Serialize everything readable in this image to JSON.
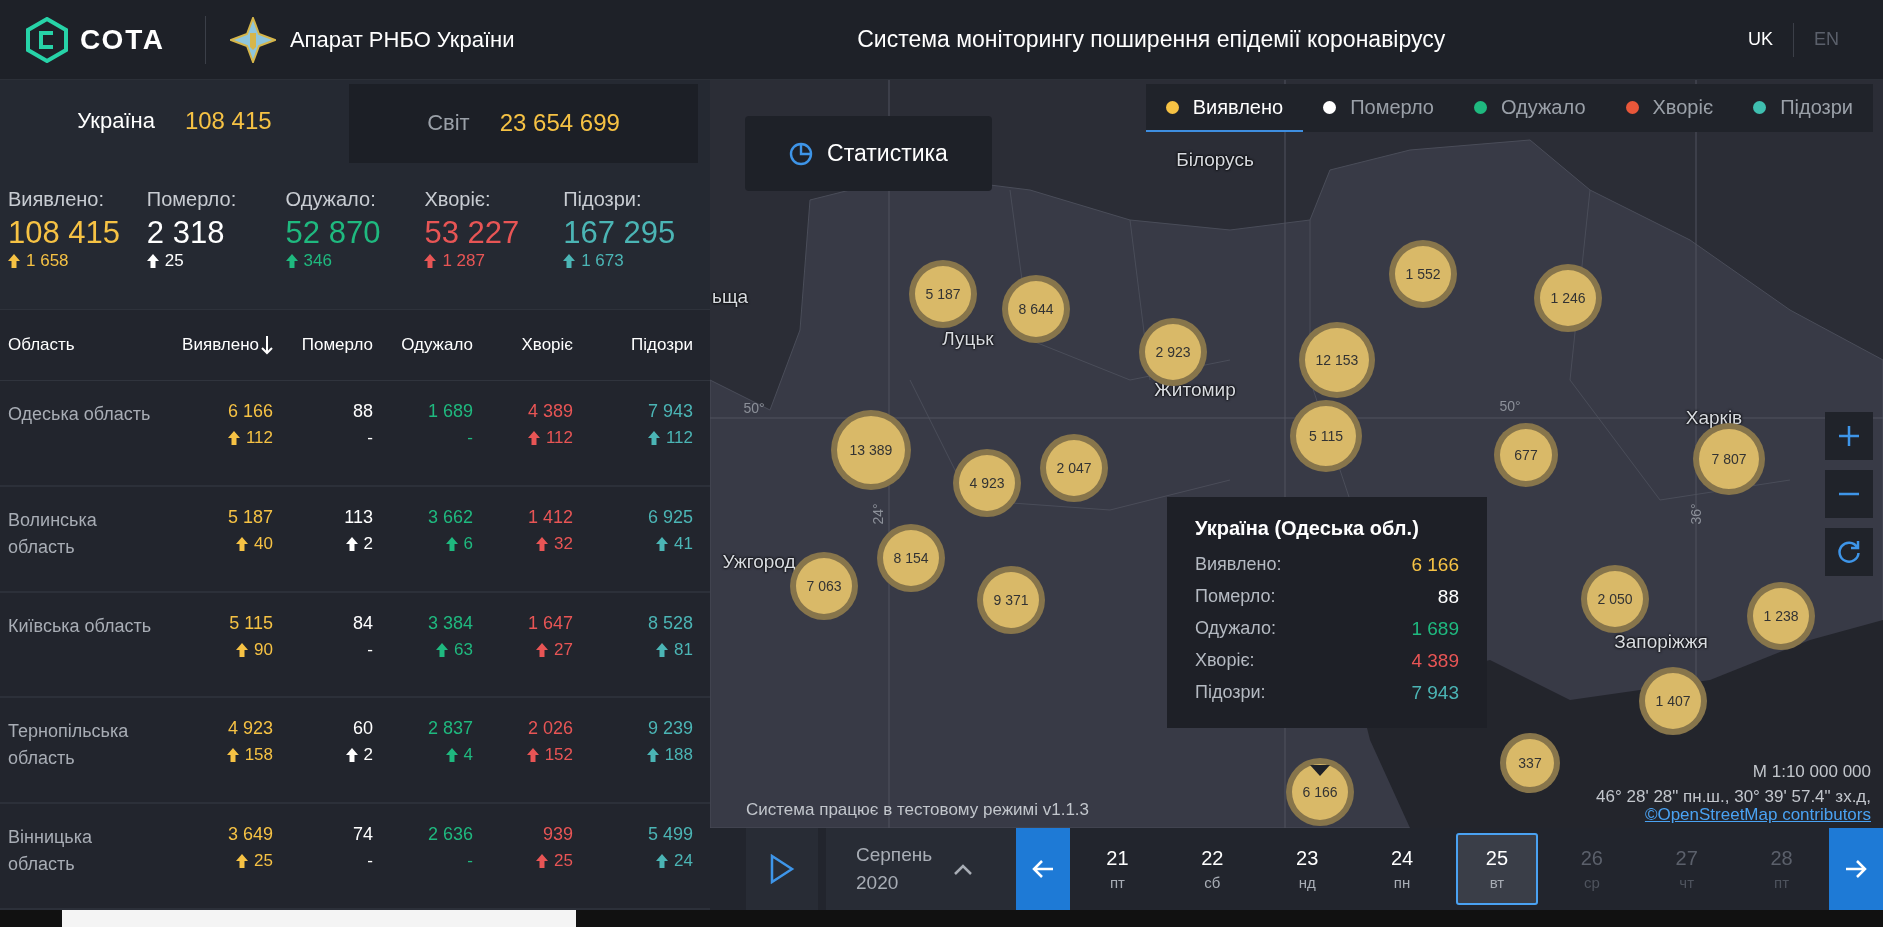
{
  "header": {
    "logo": "СОТА",
    "org": "Апарат РНБО України",
    "title": "Система моніторингу поширення епідемії коронавірусу",
    "languages": [
      {
        "label": "UK",
        "selected": true
      },
      {
        "label": "EN",
        "selected": false
      }
    ]
  },
  "scope_tabs": [
    {
      "label": "Україна",
      "value": "108 415",
      "selected": true
    },
    {
      "label": "Світ",
      "value": "23 654 699",
      "selected": false
    }
  ],
  "totals": [
    {
      "label": "Виявлено:",
      "value": "108 415",
      "delta": "1 658",
      "color": "#f6c244"
    },
    {
      "label": "Померло:",
      "value": "2 318",
      "delta": "25",
      "color": "#ffffff"
    },
    {
      "label": "Одужало:",
      "value": "52 870",
      "delta": "346",
      "color": "#1fb97f"
    },
    {
      "label": "Хворіє:",
      "value": "53 227",
      "delta": "1 287",
      "color": "#e85555"
    },
    {
      "label": "Підозри:",
      "value": "167 295",
      "delta": "1 673",
      "color": "#4bb5b5"
    }
  ],
  "table": {
    "columns": [
      {
        "label": "Область",
        "sorted": false
      },
      {
        "label": "Виявлено",
        "sorted": true,
        "color": "#f6c244"
      },
      {
        "label": "Померло",
        "sorted": false,
        "color": "#ffffff"
      },
      {
        "label": "Одужало",
        "sorted": false,
        "color": "#1fb97f"
      },
      {
        "label": "Хворіє",
        "sorted": false,
        "color": "#e85555"
      },
      {
        "label": "Підозри",
        "sorted": false,
        "color": "#4bb5b5"
      }
    ],
    "rows": [
      {
        "cells": [
          {
            "value": "Одеська область"
          },
          {
            "value": "6 166",
            "delta": "112",
            "up": true
          },
          {
            "value": "88",
            "delta": "-",
            "up": false
          },
          {
            "value": "1 689",
            "delta": "-",
            "up": false
          },
          {
            "value": "4 389",
            "delta": "112",
            "up": true
          },
          {
            "value": "7 943",
            "delta": "112",
            "up": true
          }
        ]
      },
      {
        "cells": [
          {
            "value": "Волинська область"
          },
          {
            "value": "5 187",
            "delta": "40",
            "up": true
          },
          {
            "value": "113",
            "delta": "2",
            "up": true
          },
          {
            "value": "3 662",
            "delta": "6",
            "up": true
          },
          {
            "value": "1 412",
            "delta": "32",
            "up": true
          },
          {
            "value": "6 925",
            "delta": "41",
            "up": true
          }
        ]
      },
      {
        "cells": [
          {
            "value": "Київська область"
          },
          {
            "value": "5 115",
            "delta": "90",
            "up": true
          },
          {
            "value": "84",
            "delta": "-",
            "up": false
          },
          {
            "value": "3 384",
            "delta": "63",
            "up": true
          },
          {
            "value": "1 647",
            "delta": "27",
            "up": true
          },
          {
            "value": "8 528",
            "delta": "81",
            "up": true
          }
        ]
      },
      {
        "cells": [
          {
            "value": "Тернопільська область"
          },
          {
            "value": "4 923",
            "delta": "158",
            "up": true
          },
          {
            "value": "60",
            "delta": "2",
            "up": true
          },
          {
            "value": "2 837",
            "delta": "4",
            "up": true
          },
          {
            "value": "2 026",
            "delta": "152",
            "up": true
          },
          {
            "value": "9 239",
            "delta": "188",
            "up": true
          }
        ]
      },
      {
        "cells": [
          {
            "value": "Вінницька область"
          },
          {
            "value": "3 649",
            "delta": "25",
            "up": true
          },
          {
            "value": "74",
            "delta": "-",
            "up": false
          },
          {
            "value": "2 636",
            "delta": "-",
            "up": false
          },
          {
            "value": "939",
            "delta": "25",
            "up": true
          },
          {
            "value": "5 499",
            "delta": "24",
            "up": true
          }
        ]
      }
    ]
  },
  "map": {
    "stats_button": "Статистика",
    "layers": [
      {
        "label": "Виявлено",
        "color": "#f6c244",
        "selected": true
      },
      {
        "label": "Померло",
        "color": "#ffffff",
        "selected": false
      },
      {
        "label": "Одужало",
        "color": "#1fb97f",
        "selected": false
      },
      {
        "label": "Хворіє",
        "color": "#e8573a",
        "selected": false
      },
      {
        "label": "Підозри",
        "color": "#3fbfb0",
        "selected": false
      }
    ],
    "place_labels": [
      "Білорусь",
      "Луцьк",
      "Житомир",
      "Ужгород",
      "Запоріжжя",
      "Харків",
      "ьща"
    ],
    "grid_labels": [
      "50°",
      "50°",
      "24°",
      "36°"
    ],
    "clusters": [
      "5 187",
      "8 644",
      "2 923",
      "12 153",
      "5 115",
      "1 552",
      "1 246",
      "677",
      "7 807",
      "13 389",
      "4 923",
      "2 047",
      "8 154",
      "7 063",
      "9 371",
      "2 050",
      "1 238",
      "1 407",
      "337",
      "6 166"
    ],
    "tooltip": {
      "title": "Україна (Одеська обл.)",
      "rows": [
        {
          "label": "Виявлено:",
          "value": "6 166",
          "color": "#f6c244"
        },
        {
          "label": "Померло:",
          "value": "88",
          "color": "#ffffff"
        },
        {
          "label": "Одужало:",
          "value": "1 689",
          "color": "#1fb97f"
        },
        {
          "label": "Хворіє:",
          "value": "4 389",
          "color": "#e85555"
        },
        {
          "label": "Підозри:",
          "value": "7 943",
          "color": "#4bb5b5"
        }
      ]
    },
    "scale": "M 1:10 000 000",
    "coordinates": "46° 28' 28\" пн.ш., 30° 39' 57.4\" зх.д,",
    "attribution": "©OpenStreetMap contributors",
    "status": "Система працює в тестовому режимі v1.1.3"
  },
  "timeline": {
    "month": "Серпень",
    "year": "2020",
    "days": [
      {
        "day": "21",
        "weekday": "пт",
        "selected": false,
        "disabled": false
      },
      {
        "day": "22",
        "weekday": "сб",
        "selected": false,
        "disabled": false
      },
      {
        "day": "23",
        "weekday": "нд",
        "selected": false,
        "disabled": false
      },
      {
        "day": "24",
        "weekday": "пн",
        "selected": false,
        "disabled": false
      },
      {
        "day": "25",
        "weekday": "вт",
        "selected": true,
        "disabled": false
      },
      {
        "day": "26",
        "weekday": "ср",
        "selected": false,
        "disabled": true
      },
      {
        "day": "27",
        "weekday": "чт",
        "selected": false,
        "disabled": true
      },
      {
        "day": "28",
        "weekday": "пт",
        "selected": false,
        "disabled": true
      }
    ]
  }
}
